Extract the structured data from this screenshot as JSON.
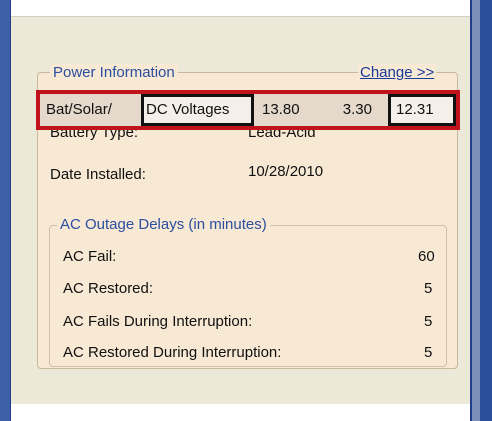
{
  "power_info": {
    "title": "Power Information",
    "change_link": "Change >>",
    "voltage_row": {
      "label": "Bat/Solar/",
      "dc_label": "DC Voltages",
      "v1": "13.80",
      "v2": "3.30",
      "v3": "12.31"
    },
    "battery_type_label": "Battery Type:",
    "battery_type_value": "Lead-Acid",
    "date_installed_label": "Date Installed:",
    "date_installed_value": "10/28/2010"
  },
  "ac_outage": {
    "title": "AC Outage Delays (in minutes)",
    "rows": [
      {
        "label": "AC Fail:",
        "value": "60"
      },
      {
        "label": "AC Restored:",
        "value": "5"
      },
      {
        "label": "AC Fails During Interruption:",
        "value": "5"
      },
      {
        "label": "AC Restored During Interruption:",
        "value": "5"
      }
    ]
  },
  "colors": {
    "panel": "#f7e9d4",
    "highlight_border": "#c0131c",
    "legend_text": "#2b4ea0",
    "window_frame": "#3d5fa8"
  }
}
